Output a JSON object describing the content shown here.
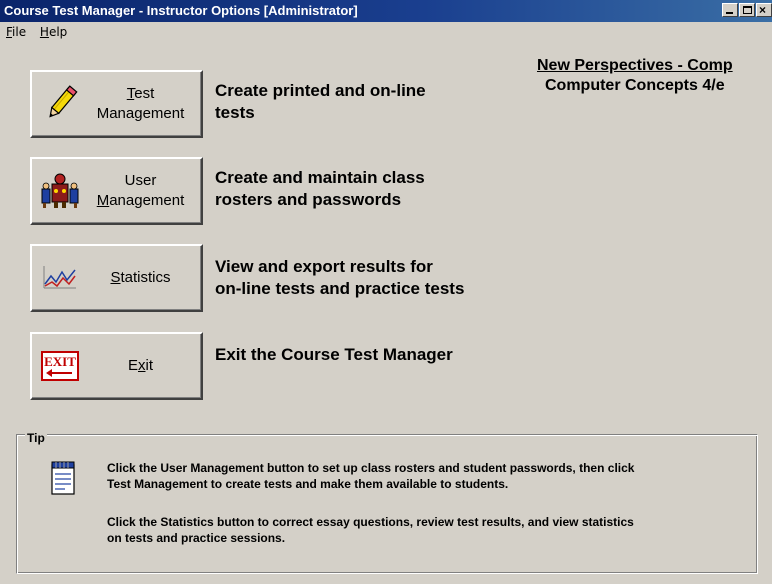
{
  "window": {
    "title": "Course Test Manager - Instructor Options [Administrator]"
  },
  "menu": {
    "file_hot": "F",
    "file_rest": "ile",
    "help_hot": "H",
    "help_rest": "elp"
  },
  "book": {
    "line1": "New Perspectives - Comp",
    "line2": "Computer Concepts 4/e"
  },
  "buttons": {
    "test": {
      "line1_hot": "T",
      "line1_rest": "est",
      "line2": "Management",
      "icon": "pencil-icon"
    },
    "user": {
      "line1": "User",
      "line2_hot": "M",
      "line2_rest": "anagement",
      "icon": "users-icon"
    },
    "stats": {
      "hot": "S",
      "rest": "tatistics",
      "icon": "line-graph-icon"
    },
    "exit": {
      "pre": "E",
      "hot": "x",
      "rest": "it",
      "icon": "exit-sign-icon",
      "sign_text": "EXIT"
    }
  },
  "descriptions": {
    "test": [
      "Create printed and on-line",
      "tests"
    ],
    "user": [
      "Create and maintain class",
      "rosters and passwords"
    ],
    "stats": [
      "View and export results for",
      "on-line tests and practice tests"
    ],
    "exit": [
      "Exit the Course Test Manager"
    ]
  },
  "tip": {
    "legend": "Tip",
    "icon": "notepad-icon",
    "p1_l1": "Click the User Management button to set up class rosters and student passwords, then click",
    "p1_l2": "Test Management to create tests and make them available to students.",
    "p2_l1": "Click the Statistics button to correct essay questions, review test results, and view statistics",
    "p2_l2": "on tests and practice sessions."
  }
}
